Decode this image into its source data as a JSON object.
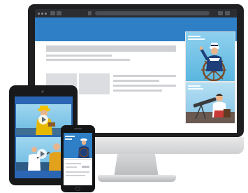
{
  "scene": {
    "description_devices": [
      "desktop-monitor",
      "tablet",
      "smartphone"
    ]
  },
  "desktop": {
    "browser": {
      "window_controls": [
        "close-dot",
        "minimize-dot",
        "maximize-dot"
      ]
    },
    "ads": [
      {
        "caption_lines": [
          "",
          ""
        ]
      },
      {
        "caption_lines": [
          "",
          ""
        ]
      }
    ]
  },
  "colors": {
    "hero_blue": "#2f7fc6",
    "tablet_bg": "#2a66b3",
    "sky": "#8fd0ee",
    "placeholder": "#cfd1d4"
  },
  "icons": {
    "play": "play-icon",
    "star": "star-icon"
  }
}
